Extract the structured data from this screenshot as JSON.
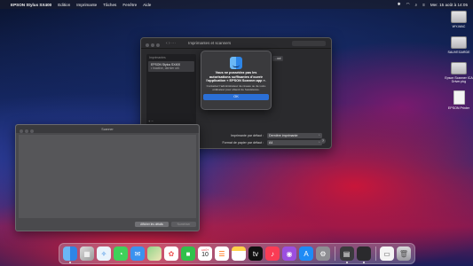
{
  "menubar": {
    "app_name": "EPSON Stylus SX400",
    "menus": [
      "Edition",
      "Imprimante",
      "Tâches",
      "Fenêtre",
      "Aide"
    ],
    "datetime": "Mer. 15 août à 14:05"
  },
  "desktop_icons": [
    {
      "label": "WY-MAC",
      "kind": "drive"
    },
    {
      "label": "SAUVEGARDE",
      "kind": "drive"
    },
    {
      "label": "Epson Scanner ICA Driver.pkg",
      "kind": "drive"
    },
    {
      "label": "EPSON Printer",
      "kind": "file"
    }
  ],
  "prefs_window": {
    "title": "Imprimantes et scanners",
    "list_header": "Imprimantes",
    "printer_name": "EPSON Stylus SX400",
    "printer_status": "• Inactive, dernier util.",
    "options_label": "...aut",
    "default_printer_label": "Imprimante par défaut :",
    "default_printer_value": "Dernière imprimante",
    "paper_size_label": "Format de papier par défaut :",
    "paper_size_value": "A4",
    "add_remove": "+ −",
    "help": "?"
  },
  "alert": {
    "message": "Vous ne possédez pas les autorisations suffisantes d'ouvrir l'application « EPSON Scanner.app ».",
    "info": "Contactez l'administrateur de réseau ou de votre ordinateur pour obtenir de l'assistance.",
    "ok_label": "OK"
  },
  "scanner_window": {
    "title": "Scanner",
    "details_label": "Afficher les détails",
    "scan_label": "Numériser"
  },
  "dock": {
    "items": [
      "Finder",
      "Launchpad",
      "Safari",
      "Messages",
      "Mail",
      "Plans",
      "Photos",
      "FaceTime",
      "Calendrier",
      "Rappels",
      "Notes",
      "TV",
      "Musique",
      "Podcasts",
      "App Store",
      "Préférences Système",
      "Imprimante",
      "Aperçu",
      "Corbeille"
    ],
    "calendar_month": "AOÛT",
    "calendar_day": "10"
  },
  "colors": {
    "accent": "#2b6fd6",
    "window_dark": "#2a2a2d"
  }
}
